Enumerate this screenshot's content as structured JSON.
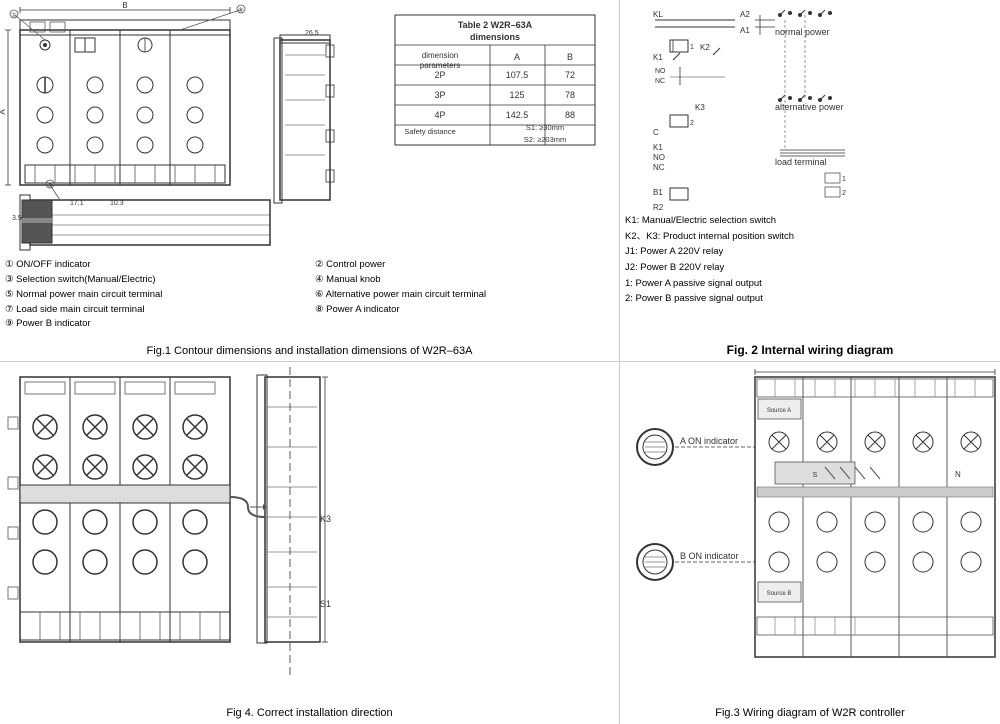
{
  "fig1": {
    "caption": "Fig.1  Contour dimensions and installation dimensions of W2R–63A",
    "table": {
      "title": "Table 2  W2R–63A\ndimensions",
      "headers": [
        "dimension\nparameters",
        "A",
        "B"
      ],
      "rows": [
        [
          "2P",
          "107.5",
          "72"
        ],
        [
          "3P",
          "125",
          "78"
        ],
        [
          "4P",
          "142.5",
          "88"
        ]
      ],
      "safety": "Safety distance",
      "s1": "S1: ≥30mm",
      "s2": "S2: ≥203mm"
    },
    "legend": [
      {
        "num": "①",
        "text": "ON/OFF indicator"
      },
      {
        "num": "②",
        "text": "Control power"
      },
      {
        "num": "③",
        "text": "Selection switch(Manual/Electric)"
      },
      {
        "num": "④",
        "text": "Manual  knob"
      },
      {
        "num": "⑤",
        "text": "Normal power main circuit terminal"
      },
      {
        "num": "⑥",
        "text": "Alternative power main circuit terminal"
      },
      {
        "num": "⑦",
        "text": "Load side main circuit terminal"
      },
      {
        "num": "⑧",
        "text": "Power A indicator"
      },
      {
        "num": "⑨",
        "text": "Power B indicator"
      }
    ]
  },
  "fig2": {
    "caption": "Fig. 2  Internal wiring diagram",
    "labels": {
      "normal_power": "normal power",
      "alternative_power": "alternative power",
      "load_terminal": "load terminal"
    },
    "wiring_notes": [
      "K1: Manual/Electric selection switch",
      "K2、K3: Product internal position switch",
      "J1: Power A 220V relay",
      "J2: Power B 220V relay",
      "1: Power A passive signal output",
      "2: Power B passive signal output"
    ]
  },
  "fig3": {
    "caption": "Fig.3 Wiring diagram of W2R controller",
    "labels": {
      "a_on": "A ON indicator",
      "b_on": "B ON indicator"
    }
  },
  "fig4": {
    "caption": "Fig 4.  Correct installation direction"
  }
}
